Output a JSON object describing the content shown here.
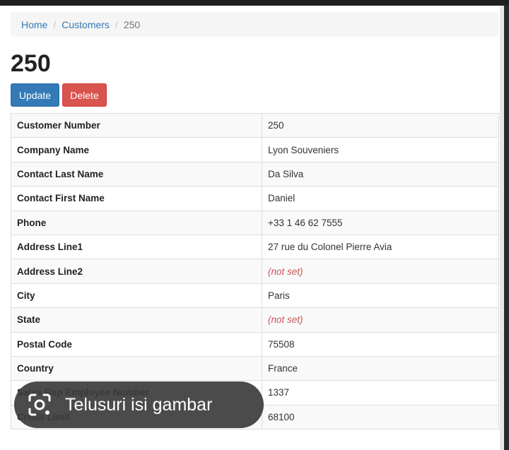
{
  "breadcrumb": {
    "items": [
      {
        "label": "Home"
      },
      {
        "label": "Customers"
      }
    ],
    "separator": "/",
    "active": "250"
  },
  "page": {
    "title": "250"
  },
  "actions": {
    "update_label": "Update",
    "delete_label": "Delete"
  },
  "details": [
    {
      "label": "Customer Number",
      "value": "250"
    },
    {
      "label": "Company Name",
      "value": "Lyon Souveniers"
    },
    {
      "label": "Contact Last Name",
      "value": "Da Silva"
    },
    {
      "label": "Contact First Name",
      "value": "Daniel"
    },
    {
      "label": "Phone",
      "value": "+33 1 46 62 7555"
    },
    {
      "label": "Address Line1",
      "value": "27 rue du Colonel Pierre Avia"
    },
    {
      "label": "Address Line2",
      "value": "(not set)",
      "not_set": true
    },
    {
      "label": "City",
      "value": "Paris"
    },
    {
      "label": "State",
      "value": "(not set)",
      "not_set": true
    },
    {
      "label": "Postal Code",
      "value": "75508"
    },
    {
      "label": "Country",
      "value": "France"
    },
    {
      "label": "Sales Rep Employee Number",
      "value": "1337"
    },
    {
      "label": "Credit Limit",
      "value": "68100"
    }
  ],
  "overlay": {
    "label": "Telusuri isi gambar",
    "icon": "lens-icon"
  },
  "colors": {
    "primary": "#337ab7",
    "danger": "#d9534f",
    "not_set": "#cc5555"
  }
}
